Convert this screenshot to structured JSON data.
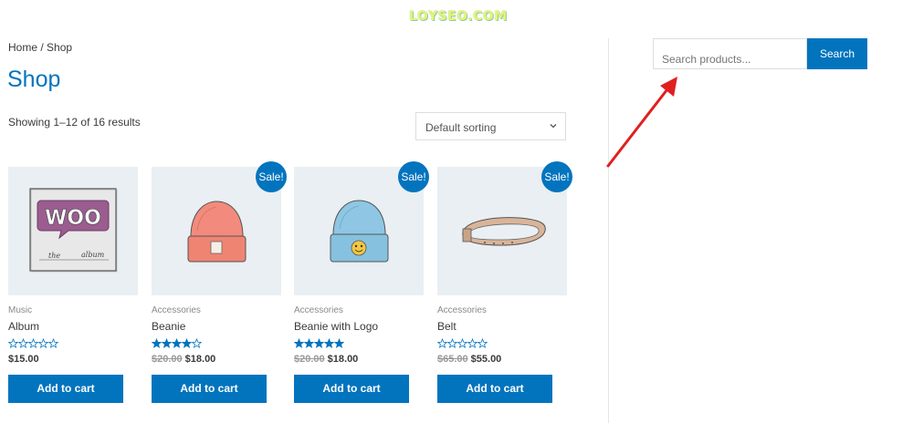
{
  "watermark": "LOYSEO.COM",
  "breadcrumb": {
    "home": "Home",
    "separator": " / ",
    "current": "Shop"
  },
  "page_title": "Shop",
  "result_count": "Showing 1–12 of 16 results",
  "ordering": {
    "selected": "Default sorting"
  },
  "search": {
    "placeholder": "Search products...",
    "button_label": "Search"
  },
  "products": [
    {
      "category": "Music",
      "name": "Album",
      "sale": false,
      "sale_label": "",
      "rating": 0,
      "price_old": "",
      "price": "$15.00",
      "button": "Add to cart",
      "image_icon": "woo-album-icon"
    },
    {
      "category": "Accessories",
      "name": "Beanie",
      "sale": true,
      "sale_label": "Sale!",
      "rating": 4,
      "price_old": "$20.00",
      "price": "$18.00",
      "button": "Add to cart",
      "image_icon": "beanie-icon"
    },
    {
      "category": "Accessories",
      "name": "Beanie with Logo",
      "sale": true,
      "sale_label": "Sale!",
      "rating": 5,
      "price_old": "$20.00",
      "price": "$18.00",
      "button": "Add to cart",
      "image_icon": "beanie-logo-icon"
    },
    {
      "category": "Accessories",
      "name": "Belt",
      "sale": true,
      "sale_label": "Sale!",
      "rating": 0,
      "price_old": "$65.00",
      "price": "$55.00",
      "button": "Add to cart",
      "image_icon": "belt-icon"
    }
  ],
  "colors": {
    "accent": "#0274be",
    "arrow": "#e02020",
    "thumb_bg": "#e9eff2"
  }
}
